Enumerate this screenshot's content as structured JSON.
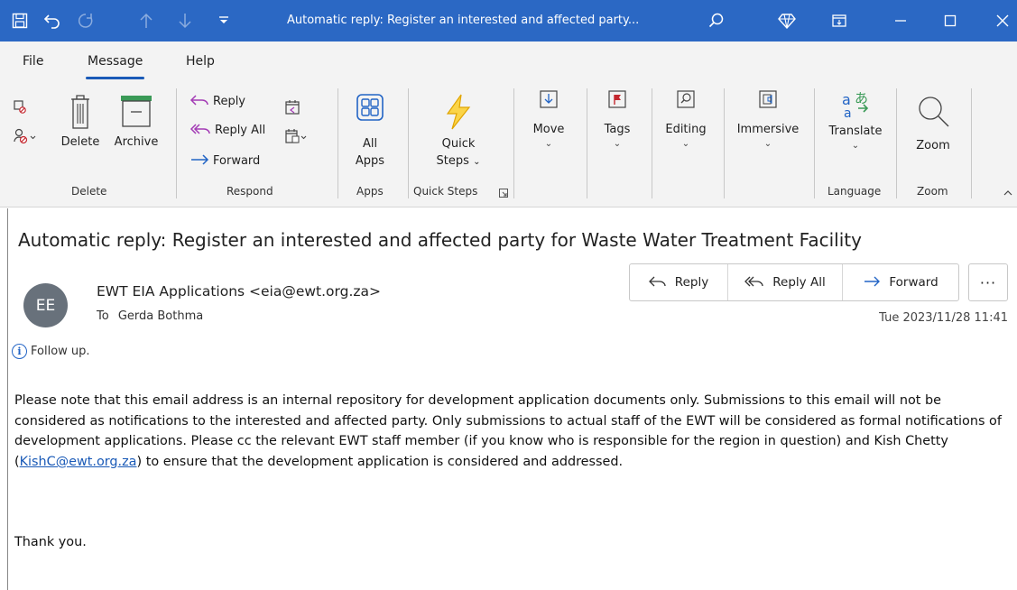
{
  "window": {
    "title": "Automatic reply: Register an interested and affected party...",
    "accent": "#2b68c4"
  },
  "menu": {
    "tabs": [
      "File",
      "Message",
      "Help"
    ],
    "active": "Message"
  },
  "ribbon": {
    "delete_group": {
      "label": "Delete",
      "delete": "Delete",
      "archive": "Archive"
    },
    "respond_group": {
      "label": "Respond",
      "reply": "Reply",
      "reply_all": "Reply All",
      "forward": "Forward"
    },
    "apps_group": {
      "label": "Apps",
      "all_apps_1": "All",
      "all_apps_2": "Apps"
    },
    "quicksteps_group": {
      "label": "Quick Steps",
      "quick_1": "Quick",
      "quick_2": "Steps"
    },
    "move": "Move",
    "tags": "Tags",
    "editing": "Editing",
    "immersive": "Immersive",
    "language_group": {
      "label": "Language",
      "translate": "Translate"
    },
    "zoom_group": {
      "label": "Zoom",
      "zoom": "Zoom"
    }
  },
  "message": {
    "subject": "Automatic reply: Register an interested and affected party for Waste Water Treatment Facility",
    "avatar_initials": "EE",
    "avatar_color": "#68717b",
    "sender": "EWT EIA Applications <eia@ewt.org.za>",
    "to_label": "To",
    "recipient": "Gerda Bothma",
    "date": "Tue 2023/11/28 11:41",
    "actions": {
      "reply": "Reply",
      "reply_all": "Reply All",
      "forward": "Forward"
    },
    "followup": "Follow up.",
    "body_before_link": "Please note that this email address is an internal repository for development application documents only. Submissions to this email will not be considered as notifications to the interested and affected party. Only submissions to actual staff of the EWT will be considered as formal notifications of development applications. Please cc the relevant EWT staff member (if you know who is responsible for the region in question) and Kish Chetty (",
    "link": "KishC@ewt.org.za",
    "body_after_link": ") to ensure that the development application is considered and addressed.",
    "closing": "Thank you."
  }
}
